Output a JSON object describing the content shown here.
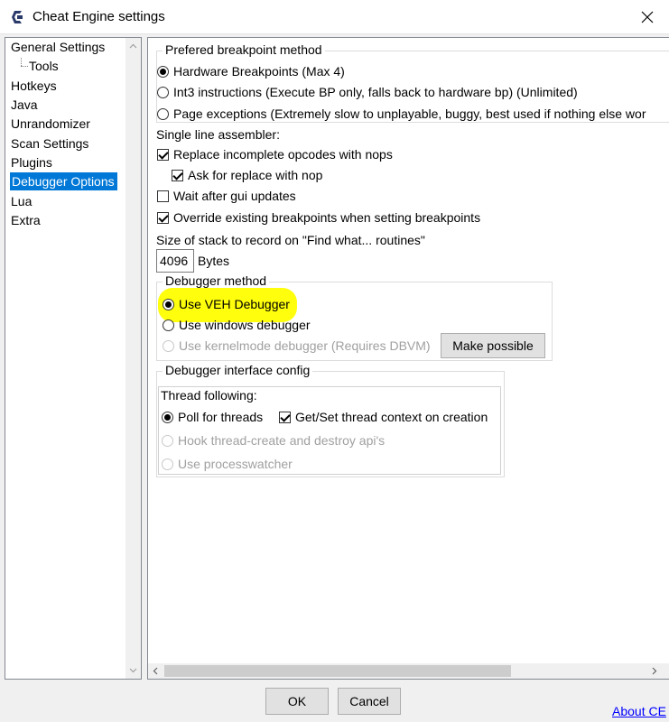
{
  "window": {
    "title": "Cheat Engine settings",
    "close_label": "✕"
  },
  "sidebar": {
    "items": [
      {
        "label": "General Settings"
      },
      {
        "label": "Tools"
      },
      {
        "label": "Hotkeys"
      },
      {
        "label": "Java"
      },
      {
        "label": "Unrandomizer"
      },
      {
        "label": "Scan Settings"
      },
      {
        "label": "Plugins"
      },
      {
        "label": "Debugger Options",
        "selected": true
      },
      {
        "label": "Lua"
      },
      {
        "label": "Extra"
      }
    ]
  },
  "breakpoint": {
    "group_title": "Prefered breakpoint method",
    "options": [
      {
        "label": "Hardware Breakpoints (Max 4)",
        "checked": true
      },
      {
        "label": "Int3 instructions (Execute BP only, falls back to hardware bp) (Unlimited)",
        "checked": false
      },
      {
        "label": "Page exceptions (Extremely slow to unplayable, buggy, best used if nothing else wor",
        "checked": false
      }
    ]
  },
  "assembler": {
    "label": "Single line assembler:",
    "replace_label": "Replace incomplete opcodes with nops",
    "ask_label": "Ask for replace with nop"
  },
  "wait_gui_label": "Wait after gui updates",
  "override_label": "Override existing breakpoints when setting breakpoints",
  "stack": {
    "label": "Size of stack to record on \"Find what... routines\"",
    "value": "4096",
    "unit": "Bytes"
  },
  "debugger_method": {
    "group_title": "Debugger method",
    "veh_label": "Use VEH Debugger",
    "windows_label": "Use windows debugger",
    "kernel_label": "Use kernelmode debugger (Requires DBVM)",
    "make_possible_label": "Make possible",
    "highlight_color": "#ffff00"
  },
  "debugger_interface": {
    "group_title": "Debugger interface config",
    "thread_following_label": "Thread following:",
    "poll_label": "Poll for threads",
    "getset_label": "Get/Set thread context on creation",
    "hook_label": "Hook thread-create and destroy api's",
    "processwatcher_label": "Use processwatcher"
  },
  "footer": {
    "ok_label": "OK",
    "cancel_label": "Cancel",
    "about_label": "About CE"
  },
  "colors": {
    "selection": "#0078d7",
    "link": "#0000ff"
  }
}
